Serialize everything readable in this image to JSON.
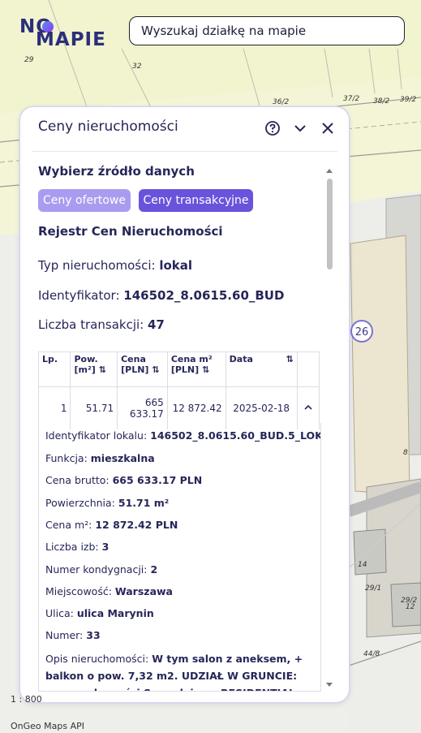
{
  "header": {
    "logo_text_line1": "NO",
    "logo_text_line2": "MAPIE",
    "search_placeholder": "Wyszukaj działkę na mapie"
  },
  "map": {
    "parcel_labels": [
      "29",
      "32",
      "36/2",
      "37/2",
      "38/2",
      "39/2",
      "8",
      "14",
      "29/1",
      "29/2",
      "12",
      "44/8"
    ],
    "building_number": "26",
    "scale": "1 : 800",
    "credit": "OnGeo Maps API"
  },
  "panel": {
    "title": "Ceny nieruchomości",
    "source_title": "Wybierz źródło danych",
    "btn_offer": "Ceny ofertowe",
    "btn_transaction": "Ceny transakcyjne",
    "registry": "Rejestr Cen Nieruchomości",
    "type_label": "Typ nieruchomości: ",
    "type_value": "lokal",
    "id_label": "Identyfikator: ",
    "id_value": "146502_8.0615.60_BUD",
    "count_label": "Liczba transakcji: ",
    "count_value": "47",
    "table": {
      "h_lp": "Lp.",
      "h_area": "Pow. [m²]",
      "h_price": "Cena [PLN]",
      "h_price_m2": "Cena m² [PLN]",
      "h_date": "Data",
      "row": {
        "lp": "1",
        "area": "51.71",
        "price": "665 633.17",
        "price_m2": "12 872.42",
        "date": "2025-02-18"
      }
    },
    "details": {
      "unit_id_label": "Identyfikator lokalu: ",
      "unit_id_value": "146502_8.0615.60_BUD.5_LOK",
      "function_label": "Funkcja: ",
      "function_value": "mieszkalna",
      "gross_label": "Cena brutto: ",
      "gross_value": "665 633.17 PLN",
      "area_label": "Powierzchnia: ",
      "area_value": "51.71 m²",
      "pricem2_label": "Cena m²: ",
      "pricem2_value": "12 872.42 PLN",
      "rooms_label": "Liczba izb: ",
      "rooms_value": "3",
      "floor_label": "Numer kondygnacji: ",
      "floor_value": "2",
      "city_label": "Miejscowość: ",
      "city_value": "Warszawa",
      "street_label": "Ulica: ",
      "street_value": "ulica Marynin",
      "number_label": "Numer: ",
      "number_value": "33",
      "desc_label": "Opis nieruchomości: ",
      "desc_value": "W tym salon z aneksem, + balkon o pow. 7,32 m2. UDZIAŁ W GRUNCIE: prawo własności Sprzedający: RESIDENTIAL CAPITOL"
    }
  }
}
